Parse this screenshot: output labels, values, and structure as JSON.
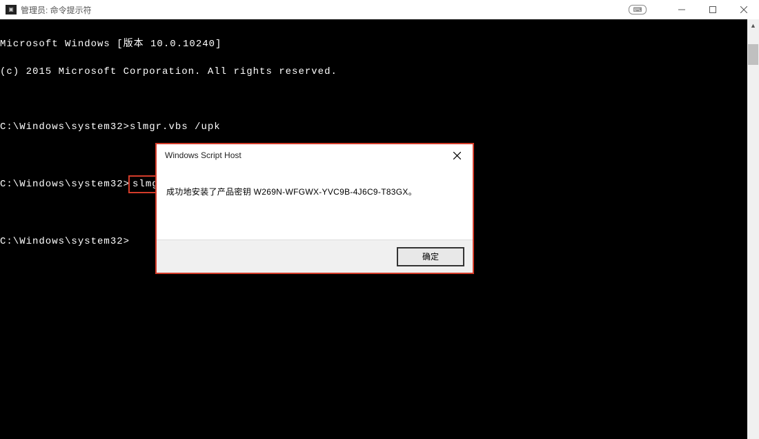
{
  "titlebar": {
    "label": "管理员: 命令提示符"
  },
  "terminal": {
    "line1": "Microsoft Windows [版本 10.0.10240]",
    "line2": "(c) 2015 Microsoft Corporation. All rights reserved.",
    "line3_prompt": "C:\\Windows\\system32>",
    "line3_cmd": "slmgr.vbs /upk",
    "line4_prompt": "C:\\Windows\\system32>",
    "line4_cmd": "slmgr /ipk W269N-WFGWX-YVC9B-4J6C9-T83GX",
    "line5_prompt": "C:\\Windows\\system32>"
  },
  "dialog": {
    "title": "Windows Script Host",
    "message": "成功地安装了产品密钥 W269N-WFGWX-YVC9B-4J6C9-T83GX。",
    "ok_label": "确定"
  }
}
